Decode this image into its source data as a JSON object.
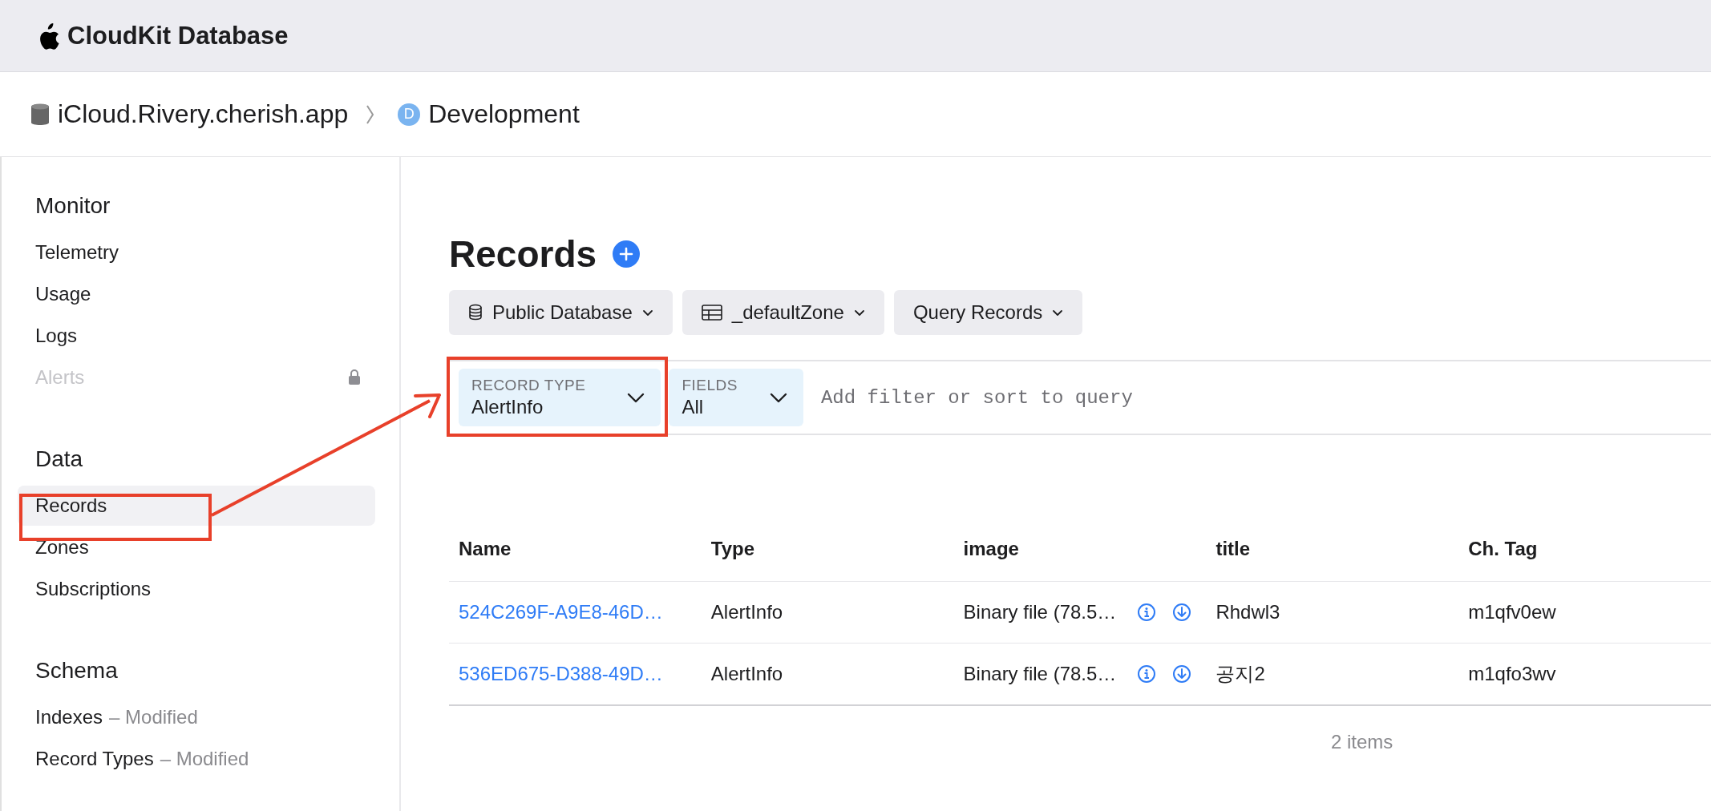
{
  "header": {
    "title": "CloudKit Database"
  },
  "breadcrumb": {
    "container": "iCloud.Rivery.cherish.app",
    "environment_badge": "D",
    "environment": "Development"
  },
  "sidebar": {
    "sections": [
      {
        "title": "Monitor",
        "items": [
          {
            "label": "Telemetry",
            "disabled": false,
            "locked": false,
            "selected": false
          },
          {
            "label": "Usage",
            "disabled": false,
            "locked": false,
            "selected": false
          },
          {
            "label": "Logs",
            "disabled": false,
            "locked": false,
            "selected": false
          },
          {
            "label": "Alerts",
            "disabled": true,
            "locked": true,
            "selected": false
          }
        ]
      },
      {
        "title": "Data",
        "items": [
          {
            "label": "Records",
            "disabled": false,
            "locked": false,
            "selected": true
          },
          {
            "label": "Zones",
            "disabled": false,
            "locked": false,
            "selected": false
          },
          {
            "label": "Subscriptions",
            "disabled": false,
            "locked": false,
            "selected": false
          }
        ]
      },
      {
        "title": "Schema",
        "items": [
          {
            "label": "Indexes",
            "note": "– Modified",
            "disabled": false,
            "locked": false,
            "selected": false
          },
          {
            "label": "Record Types",
            "note": "– Modified",
            "disabled": false,
            "locked": false,
            "selected": false
          }
        ]
      }
    ]
  },
  "main": {
    "title": "Records",
    "toolbar": [
      {
        "kind": "database",
        "label": "Public Database"
      },
      {
        "kind": "table",
        "label": "_defaultZone"
      },
      {
        "kind": "plain",
        "label": "Query Records"
      }
    ],
    "filter": {
      "chips": [
        {
          "label": "RECORD TYPE",
          "value": "AlertInfo"
        },
        {
          "label": "FIELDS",
          "value": "All"
        }
      ],
      "placeholder": "Add filter or sort to query"
    },
    "table": {
      "columns": [
        {
          "label": "Name",
          "kind": "link"
        },
        {
          "label": "Type",
          "kind": "text"
        },
        {
          "label": "image",
          "kind": "file"
        },
        {
          "label": "title",
          "kind": "text"
        },
        {
          "label": "Ch. Tag",
          "kind": "text"
        }
      ],
      "rows": [
        {
          "cells": [
            "524C269F-A9E8-46D…",
            "AlertInfo",
            "Binary file (78.5…",
            "Rhdwl3",
            "m1qfv0ew"
          ]
        },
        {
          "cells": [
            "536ED675-D388-49D…",
            "AlertInfo",
            "Binary file (78.5…",
            "공지2",
            "m1qfo3wv"
          ]
        }
      ]
    },
    "footer": "2 items"
  }
}
